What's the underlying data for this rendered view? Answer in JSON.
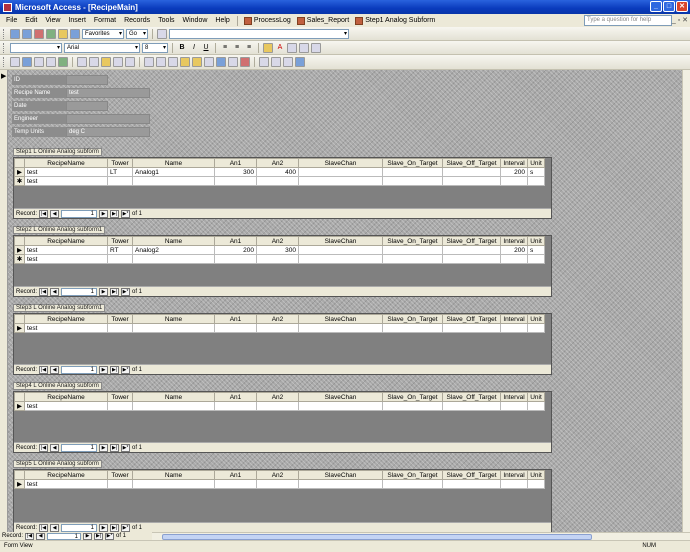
{
  "window": {
    "title": "Microsoft Access - [RecipeMain]"
  },
  "menu": {
    "items": [
      "File",
      "Edit",
      "View",
      "Insert",
      "Format",
      "Records",
      "Tools",
      "Window",
      "Help"
    ],
    "quick": [
      "ProcessLog",
      "Sales_Report",
      "Step1 Analog Subform"
    ],
    "help_placeholder": "Type a question for help"
  },
  "toolbar": {
    "font_name": "Arial",
    "font_size": "8",
    "favorites": "Favorites",
    "go": "Go"
  },
  "form": {
    "fields": [
      {
        "label": "ID",
        "value": ""
      },
      {
        "label": "Recipe Name",
        "value": "test"
      },
      {
        "label": "Date",
        "value": ""
      },
      {
        "label": "Engineer",
        "value": ""
      },
      {
        "label": "Temp Units",
        "value": "deg C"
      }
    ]
  },
  "columns": [
    "RecipeName",
    "Tower",
    "Name",
    "An1",
    "An2",
    "SlaveChan",
    "Slave_On_Target",
    "Slave_Off_Target",
    "Interval",
    "Unit"
  ],
  "subforms": [
    {
      "caption": "Step1 L Online Analog subform",
      "rows": [
        [
          "test",
          "LT",
          "Analog1",
          "300",
          "400",
          "",
          "",
          "",
          "200",
          "s"
        ]
      ],
      "new_row": "test",
      "record": "1",
      "of": "of 1"
    },
    {
      "caption": "Step2 L Online Analog subform1",
      "rows": [
        [
          "test",
          "RT",
          "Analog2",
          "200",
          "300",
          "",
          "",
          "",
          "200",
          "s"
        ]
      ],
      "new_row": "test",
      "record": "1",
      "of": "of 1"
    },
    {
      "caption": "Step3 L Online Analog subform1",
      "rows": [],
      "new_row": "test",
      "record": "1",
      "of": "of 1"
    },
    {
      "caption": "Step4 L Online Analog subform",
      "rows": [],
      "new_row": "test",
      "record": "1",
      "of": "of 1"
    },
    {
      "caption": "Step5 L Online Analog subform",
      "rows": [],
      "new_row": "test",
      "record": "1",
      "of": "of 1"
    }
  ],
  "nav": {
    "record_label": "Record:"
  },
  "main_nav": {
    "record_label": "Record:",
    "record": "1",
    "of": "of 1"
  },
  "status": {
    "left": "Form View",
    "right": "NUM"
  }
}
